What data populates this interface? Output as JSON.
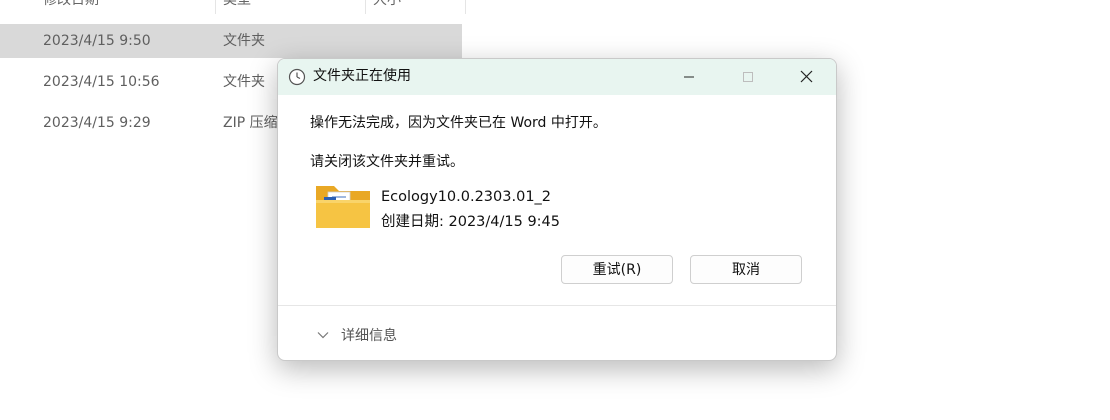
{
  "explorer": {
    "columns": [
      "修改日期",
      "类型",
      "大小"
    ],
    "rows": [
      {
        "date": "2023/4/15 9:50",
        "type": "文件夹"
      },
      {
        "date": "2023/4/15 10:56",
        "type": "文件夹"
      },
      {
        "date": "2023/4/15 9:29",
        "type": "ZIP 压缩"
      }
    ]
  },
  "dialog": {
    "title": "文件夹正在使用",
    "message": "操作无法完成，因为文件夹已在 Word 中打开。",
    "instruction": "请关闭该文件夹并重试。",
    "file": {
      "name": "Ecology10.0.2303.01_2",
      "created": "创建日期: 2023/4/15 9:45"
    },
    "buttons": {
      "retry": "重试(R)",
      "cancel": "取消"
    },
    "details_label": "详细信息",
    "icons": {
      "title": "clock-icon",
      "minimize": "minimize-icon",
      "maximize": "maximize-icon",
      "close": "close-icon",
      "file": "folder-word-icon",
      "details": "chevron-down-icon"
    }
  },
  "colors": {
    "titlebar_bg": "#e8f5f0",
    "selected_row": "#d9d9d9",
    "folder_yellow": "#f6c443",
    "word_blue": "#2b5fb4"
  }
}
